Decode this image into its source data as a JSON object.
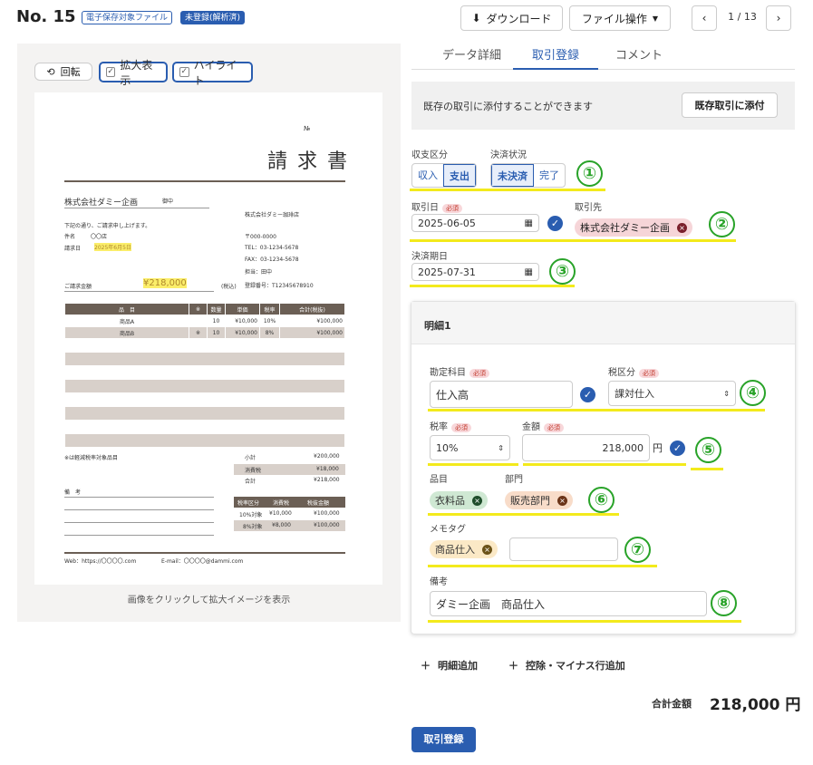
{
  "header": {
    "title": "No. 15",
    "badge_electronic": "電子保存対象ファイル",
    "badge_status": "未登録(解析済)",
    "download_label": "ダウンロード",
    "file_ops_label": "ファイル操作",
    "page_indicator": "1 / 13"
  },
  "viewer": {
    "rotate_label": "回転",
    "zoom_label": "拡大表示",
    "highlight_label": "ハイライト",
    "footer_text": "画像をクリックして拡大イメージを表示"
  },
  "invoice": {
    "no_label": "№",
    "title": "請 求 書",
    "recipient": "株式会社ダミー企画",
    "recipient_suffix": "御中",
    "intro": "下記の通り、ご請求申し上げます。",
    "subject_label": "件名",
    "subject": "〇〇店",
    "date_label": "請求日",
    "date": "2025年6月5日",
    "sender": "株式会社ダミー珈琲店",
    "zip": "〒000-0000",
    "tel": "TEL：03-1234-5678",
    "fax": "FAX：03-1234-5678",
    "rep": "担当：田中",
    "reg": "登録番号：T12345678910",
    "amount_label": "ご請求金額",
    "amount": "¥218,000",
    "tax_incl": "(税込)",
    "col_item": "品　目",
    "col_mark": "※",
    "col_qty": "数量",
    "col_price": "単価",
    "col_rate": "税率",
    "col_total": "合計(税抜)",
    "rows": [
      {
        "item": "商品A",
        "mark": "",
        "qty": "10",
        "price": "¥10,000",
        "rate": "10%",
        "total": "¥100,000"
      },
      {
        "item": "商品B",
        "mark": "※",
        "qty": "10",
        "price": "¥10,000",
        "rate": "8%",
        "total": "¥100,000"
      }
    ],
    "note_reduced": "※は軽減税率対象品目",
    "subtotal_label": "小計",
    "subtotal": "¥200,000",
    "tax_label": "消費税",
    "tax": "¥18,000",
    "total_label": "合計",
    "total": "¥218,000",
    "remarks_label": "備　考",
    "rt_col1": "税率区分",
    "rt_col2": "消費税",
    "rt_col3": "税抜金額",
    "rt_rows": [
      {
        "cat": "10%対象",
        "tax": "¥10,000",
        "base": "¥100,000"
      },
      {
        "cat": "8%対象",
        "tax": "¥8,000",
        "base": "¥100,000"
      }
    ],
    "web": "Web：https://〇〇〇〇.com",
    "email": "E-mail：〇〇〇〇@dammi.com"
  },
  "tabs": {
    "details": "データ詳細",
    "register": "取引登録",
    "comment": "コメント"
  },
  "attach": {
    "text": "既存の取引に添付することができます",
    "button": "既存取引に添付"
  },
  "form": {
    "type_label": "収支区分",
    "income": "収入",
    "expense": "支出",
    "settle_label": "決済状況",
    "unsettled": "未決済",
    "settled": "完了",
    "date_label": "取引日",
    "required": "必須",
    "date_value": "2025-06-05",
    "partner_label": "取引先",
    "partner": "株式会社ダミー企画",
    "due_label": "決済期日",
    "due_value": "2025-07-31"
  },
  "detail": {
    "title": "明細1",
    "account_label": "勘定科目",
    "account": "仕入高",
    "taxcat_label": "税区分",
    "taxcat": "課対仕入",
    "rate_label": "税率",
    "rate": "10%",
    "amount_label": "金額",
    "amount": "218,000",
    "yen": "円",
    "item_label": "品目",
    "item": "衣料品",
    "dept_label": "部門",
    "dept": "販売部門",
    "memo_label": "メモタグ",
    "memo": "商品仕入",
    "remarks_label": "備考",
    "remarks": "ダミー企画　商品仕入"
  },
  "footer": {
    "add_detail": "明細追加",
    "add_deduction": "控除・マイナス行追加",
    "total_label": "合計金額",
    "total_value": "218,000 円",
    "submit": "取引登録"
  },
  "markers": [
    "①",
    "②",
    "③",
    "④",
    "⑤",
    "⑥",
    "⑦",
    "⑧"
  ]
}
